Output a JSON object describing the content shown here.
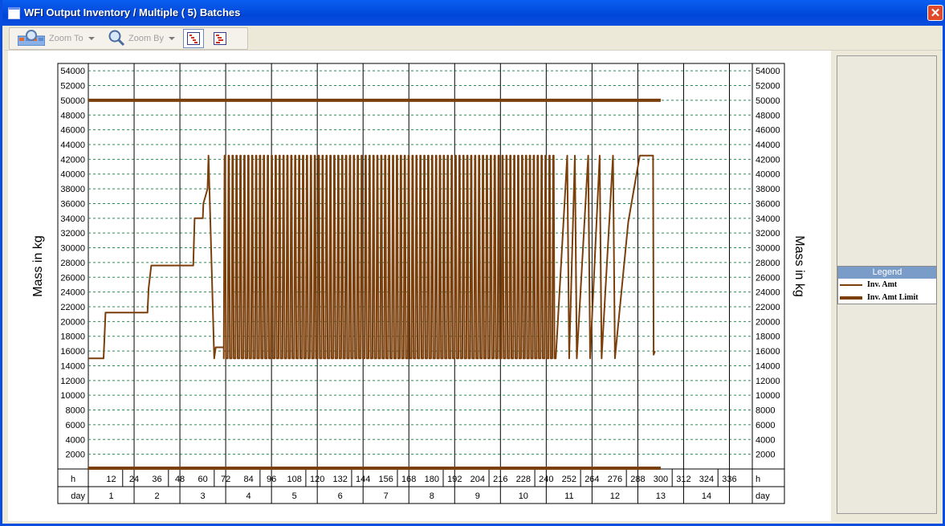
{
  "window": {
    "title": "WFI Output Inventory / Multiple ( 5) Batches",
    "close_glyph": "✕"
  },
  "toolbar": {
    "zoom_to_label": "Zoom To",
    "zoom_by_label": "Zoom By"
  },
  "legend": {
    "header": "Legend",
    "items": [
      {
        "label": "Inv. Amt",
        "color": "#7b3f0b"
      },
      {
        "label": "Inv. Amt Limit",
        "color": "#7b3f0b"
      }
    ]
  },
  "chart_data": {
    "type": "line",
    "ylabel_left": "Mass in kg",
    "ylabel_right": "Mass in kg",
    "ylim": [
      0,
      55000
    ],
    "xlim_h": [
      0,
      348
    ],
    "grid": true,
    "legend_position": "right",
    "y_ticks": [
      2000,
      4000,
      6000,
      8000,
      10000,
      12000,
      14000,
      16000,
      18000,
      20000,
      22000,
      24000,
      26000,
      28000,
      30000,
      32000,
      34000,
      36000,
      38000,
      40000,
      42000,
      44000,
      46000,
      48000,
      50000,
      52000,
      54000
    ],
    "x_hour_row_label": "h",
    "x_day_row_label": "day",
    "x_hour_ticks": [
      "12",
      "24",
      "36",
      "48",
      "60",
      "72",
      "84",
      "96",
      "108",
      "120",
      "132",
      "144",
      "156",
      "168",
      "180",
      "192",
      "204",
      "216",
      "228",
      "240",
      "252",
      "264",
      "276",
      "288",
      "300",
      "312",
      "324",
      "336"
    ],
    "x_day_ticks": [
      "1",
      "2",
      "3",
      "4",
      "5",
      "6",
      "7",
      "8",
      "9",
      "10",
      "11",
      "12",
      "13",
      "14"
    ],
    "series": [
      {
        "name": "Inv. Amt",
        "color": "#7b3f0b",
        "x": [
          0,
          8,
          8.5,
          9,
          14,
          17,
          18,
          19.5,
          22,
          22.3,
          30,
          31,
          31.6,
          33,
          40,
          41,
          41.6,
          42,
          47,
          48,
          48.5,
          49.5,
          55,
          55.7,
          56.2,
          56.6,
          57,
          59,
          60,
          60.3,
          62.5,
          63,
          66,
          66.8,
          67.3,
          67.8,
          68,
          70,
          71
        ],
        "y": [
          15000,
          15000,
          18000,
          21200,
          21200,
          21200,
          21200,
          21200,
          21200,
          21200,
          21200,
          21200,
          24500,
          27600,
          27600,
          27600,
          27600,
          27600,
          27600,
          27600,
          27600,
          27600,
          27600,
          34000,
          34000,
          34000,
          34000,
          34000,
          34000,
          36000,
          38000,
          42500,
          15000,
          16500,
          16500,
          16500,
          16500,
          16500,
          16500
        ],
        "oscillation": {
          "x_start": 71,
          "x_end": 245,
          "period_h": 2.05,
          "low": 15000,
          "high": 42500
        },
        "tail": {
          "x": [
            245,
            251,
            252,
            255,
            256,
            262,
            263,
            268,
            269,
            275,
            276,
            283,
            289,
            290,
            296
          ],
          "y": [
            15000,
            42500,
            15000,
            42500,
            15000,
            42500,
            15000,
            42500,
            15000,
            42500,
            15000,
            33500,
            42500,
            42500,
            42500
          ]
        },
        "end": {
          "x": [
            296,
            296.3,
            297
          ],
          "y": [
            42500,
            15500,
            16000
          ]
        }
      },
      {
        "name": "Inv. Amt Limit",
        "color": "#7b3f0b",
        "x": [
          0,
          300
        ],
        "y": [
          50000,
          50000
        ]
      },
      {
        "name": "",
        "color": "#7b3f0b",
        "x": [
          0,
          300
        ],
        "y": [
          0,
          0
        ]
      }
    ]
  }
}
